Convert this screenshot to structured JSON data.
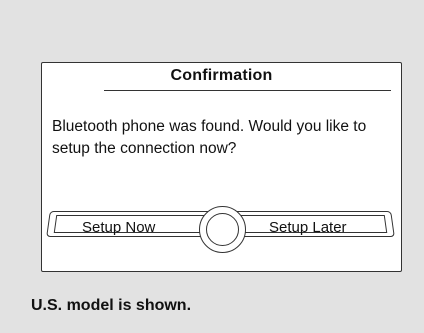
{
  "dialog": {
    "title": "Confirmation",
    "message": "Bluetooth phone was found. Would  you like to setup the connection now?",
    "buttons": {
      "setup_now": "Setup Now",
      "setup_later": "Setup Later"
    }
  },
  "caption": "U.S. model is shown.",
  "colors": {
    "background": "#e2e2e2",
    "screen": "#ffffff",
    "outline": "#333333"
  },
  "icons": {
    "selector_knob": "selector-knob-icon"
  }
}
